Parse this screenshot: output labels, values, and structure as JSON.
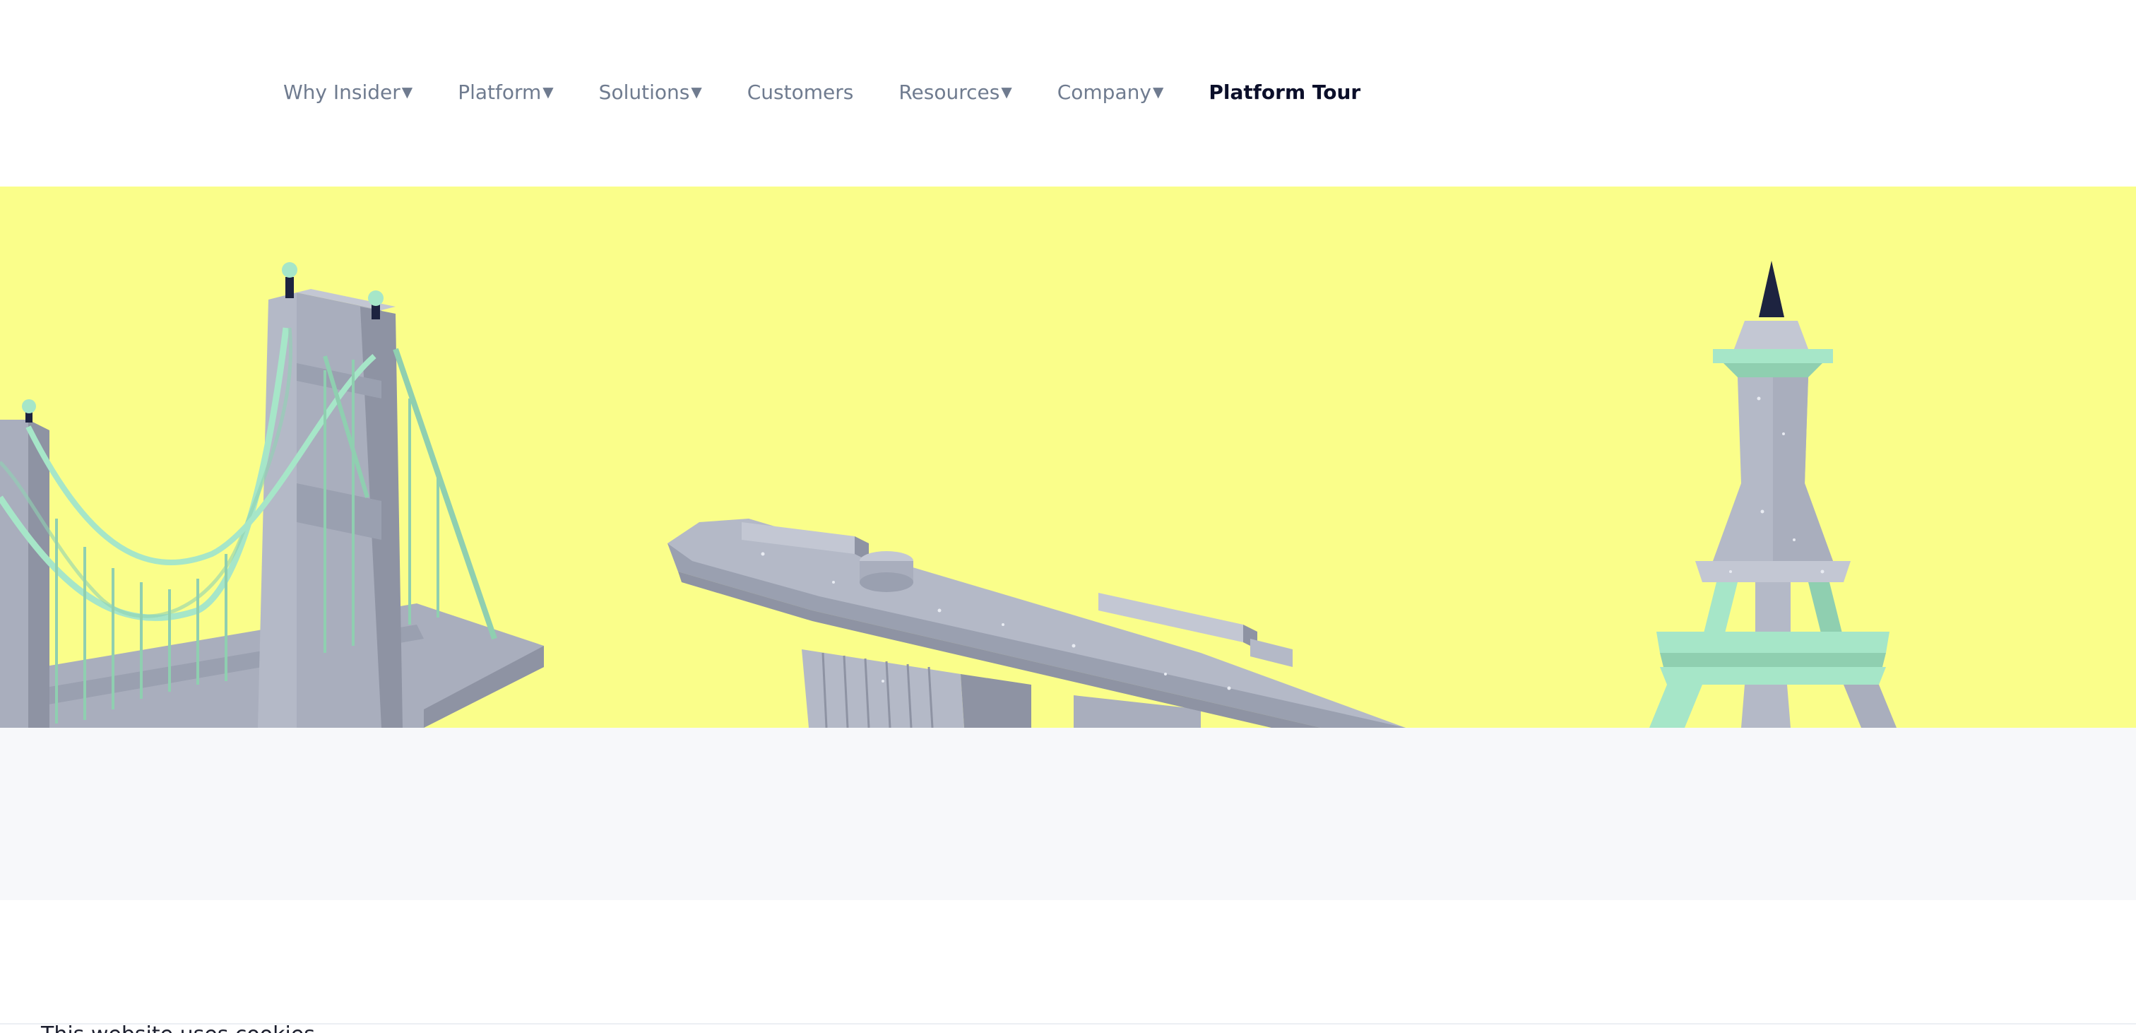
{
  "nav": {
    "items": [
      {
        "label": "Why Insider",
        "caret": "▼"
      },
      {
        "label": "Platform",
        "caret": "▼"
      },
      {
        "label": "Solutions",
        "caret": "▼"
      },
      {
        "label": "Customers",
        "caret": ""
      },
      {
        "label": "Resources",
        "caret": "▼"
      },
      {
        "label": "Company",
        "caret": "▼"
      }
    ],
    "tour_label": "Platform Tour"
  },
  "colors": {
    "hero_bg": "#fafe8a",
    "structure_grey": "#a9aebd",
    "structure_mint": "#a6e6c8",
    "dark_navy": "#1d2340"
  },
  "illustrations": [
    "suspension-bridge",
    "rooftop-skypark-building",
    "eiffel-tower"
  ],
  "footer": {
    "partial_text": "This website uses cookies"
  }
}
